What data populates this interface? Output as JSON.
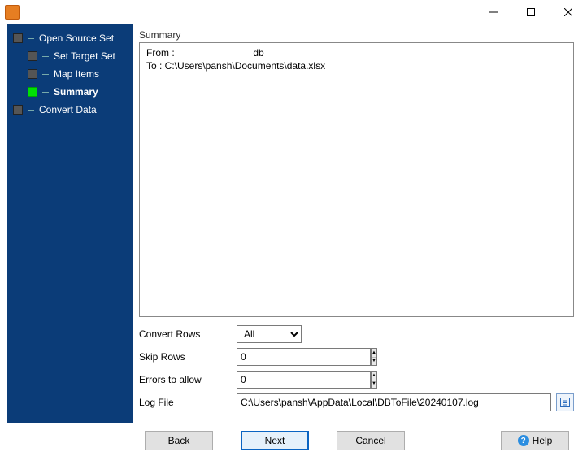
{
  "sidebar": {
    "items": [
      {
        "label": "Open Source Set"
      },
      {
        "label": "Set Target Set"
      },
      {
        "label": "Map Items"
      },
      {
        "label": "Summary"
      },
      {
        "label": "Convert Data"
      }
    ]
  },
  "main": {
    "section_title": "Summary",
    "summary_text": "From :                             db\nTo : C:\\Users\\pansh\\Documents\\data.xlsx",
    "labels": {
      "convert_rows": "Convert Rows",
      "skip_rows": "Skip Rows",
      "errors_to_allow": "Errors to allow",
      "log_file": "Log File"
    },
    "values": {
      "convert_rows": "All",
      "skip_rows": "0",
      "errors_to_allow": "0",
      "log_file": "C:\\Users\\pansh\\AppData\\Local\\DBToFile\\20240107.log"
    }
  },
  "buttons": {
    "back": "Back",
    "next": "Next",
    "cancel": "Cancel",
    "help": "Help"
  }
}
